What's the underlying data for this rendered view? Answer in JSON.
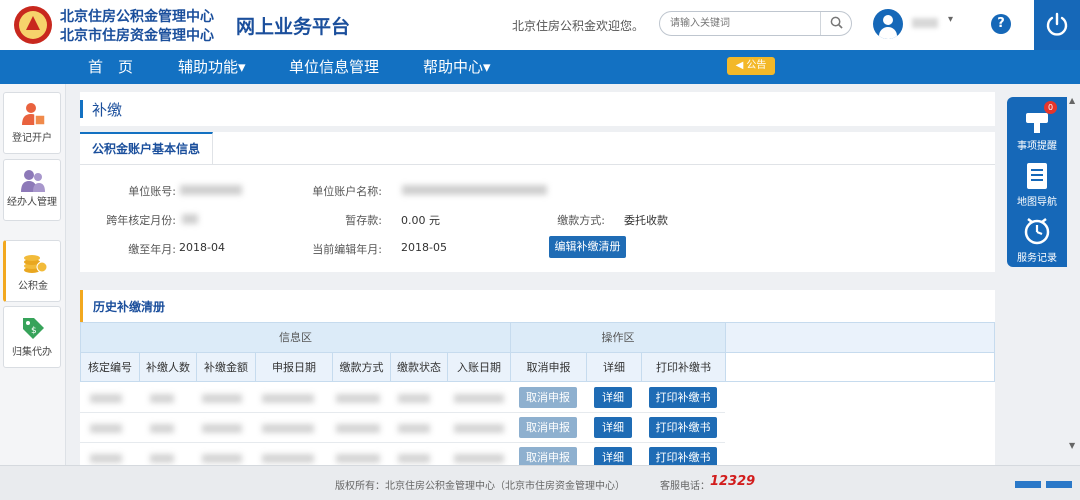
{
  "header": {
    "org_line1": "北京住房公积金管理中心",
    "org_line2": "北京市住房资金管理中心",
    "platform": "网上业务平台",
    "welcome": "北京住房公积金欢迎您。",
    "search_placeholder": "请输入关键词",
    "user_caret": "▾",
    "help": "?"
  },
  "nav": {
    "items": [
      "首　页",
      "辅助功能▾",
      "单位信息管理",
      "帮助中心▾"
    ],
    "notice": "◀ 公告"
  },
  "sidebar": {
    "items": [
      {
        "label": "登记开户"
      },
      {
        "label": "经办人管理"
      },
      {
        "label": "公积金"
      },
      {
        "label": "归集代办"
      }
    ]
  },
  "page": {
    "title": "补缴"
  },
  "account_panel": {
    "tab": "公积金账户基本信息",
    "labels": {
      "unit_no": "单位账号:",
      "unit_name": "单位账户名称:",
      "cross_year": "跨年核定月份:",
      "temp_deposit": "暂存款:",
      "pay_method": "缴款方式:",
      "paid_to": "缴至年月:",
      "editing_month": "当前编辑年月:"
    },
    "values": {
      "temp_deposit": "0.00 元",
      "pay_method": "委托收款",
      "paid_to": "2018-04",
      "editing_month": "2018-05"
    },
    "edit_button": "编辑补缴清册"
  },
  "history_panel": {
    "title": "历史补缴清册",
    "group_info": "信息区",
    "group_ops": "操作区",
    "columns": [
      "核定编号",
      "补缴人数",
      "补缴金额",
      "申报日期",
      "缴款方式",
      "缴款状态",
      "入账日期",
      "取消申报",
      "详细",
      "打印补缴书"
    ],
    "rows": [
      {
        "cancel": "取消申报",
        "detail": "详细",
        "print": "打印补缴书"
      },
      {
        "cancel": "取消申报",
        "detail": "详细",
        "print": "打印补缴书"
      },
      {
        "cancel": "取消申报",
        "detail": "详细",
        "print": "打印补缴书"
      }
    ]
  },
  "right_panel": {
    "items": [
      {
        "label": "事项提醒",
        "badge": "0"
      },
      {
        "label": "地图导航"
      },
      {
        "label": "服务记录"
      }
    ]
  },
  "footer": {
    "copyright": "版权所有：北京住房公积金管理中心（北京市住房资金管理中心）",
    "phone_label": "客服电话：",
    "phone": "12329"
  },
  "colors": {
    "primary": "#1371c2",
    "accent": "#f2a81f",
    "button": "#1f6cb5",
    "disabled_button": "#8eb0cf",
    "phone": "#d21d1d"
  }
}
